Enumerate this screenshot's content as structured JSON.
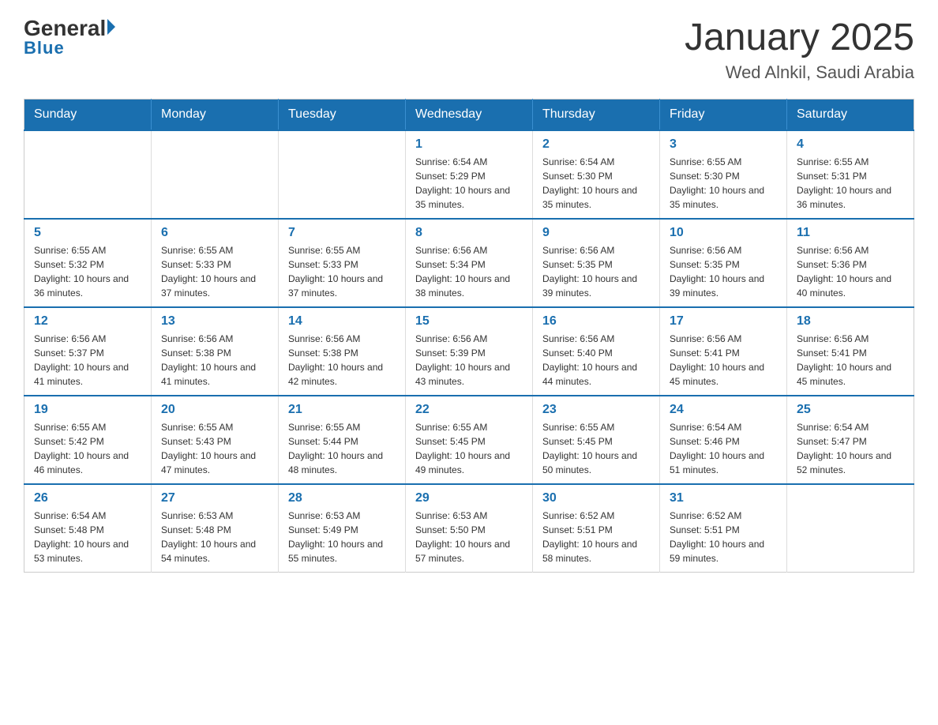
{
  "logo": {
    "general": "General",
    "blue": "Blue"
  },
  "title": "January 2025",
  "subtitle": "Wed Alnkil, Saudi Arabia",
  "days_header": [
    "Sunday",
    "Monday",
    "Tuesday",
    "Wednesday",
    "Thursday",
    "Friday",
    "Saturday"
  ],
  "weeks": [
    [
      {
        "num": "",
        "info": ""
      },
      {
        "num": "",
        "info": ""
      },
      {
        "num": "",
        "info": ""
      },
      {
        "num": "1",
        "info": "Sunrise: 6:54 AM\nSunset: 5:29 PM\nDaylight: 10 hours and 35 minutes."
      },
      {
        "num": "2",
        "info": "Sunrise: 6:54 AM\nSunset: 5:30 PM\nDaylight: 10 hours and 35 minutes."
      },
      {
        "num": "3",
        "info": "Sunrise: 6:55 AM\nSunset: 5:30 PM\nDaylight: 10 hours and 35 minutes."
      },
      {
        "num": "4",
        "info": "Sunrise: 6:55 AM\nSunset: 5:31 PM\nDaylight: 10 hours and 36 minutes."
      }
    ],
    [
      {
        "num": "5",
        "info": "Sunrise: 6:55 AM\nSunset: 5:32 PM\nDaylight: 10 hours and 36 minutes."
      },
      {
        "num": "6",
        "info": "Sunrise: 6:55 AM\nSunset: 5:33 PM\nDaylight: 10 hours and 37 minutes."
      },
      {
        "num": "7",
        "info": "Sunrise: 6:55 AM\nSunset: 5:33 PM\nDaylight: 10 hours and 37 minutes."
      },
      {
        "num": "8",
        "info": "Sunrise: 6:56 AM\nSunset: 5:34 PM\nDaylight: 10 hours and 38 minutes."
      },
      {
        "num": "9",
        "info": "Sunrise: 6:56 AM\nSunset: 5:35 PM\nDaylight: 10 hours and 39 minutes."
      },
      {
        "num": "10",
        "info": "Sunrise: 6:56 AM\nSunset: 5:35 PM\nDaylight: 10 hours and 39 minutes."
      },
      {
        "num": "11",
        "info": "Sunrise: 6:56 AM\nSunset: 5:36 PM\nDaylight: 10 hours and 40 minutes."
      }
    ],
    [
      {
        "num": "12",
        "info": "Sunrise: 6:56 AM\nSunset: 5:37 PM\nDaylight: 10 hours and 41 minutes."
      },
      {
        "num": "13",
        "info": "Sunrise: 6:56 AM\nSunset: 5:38 PM\nDaylight: 10 hours and 41 minutes."
      },
      {
        "num": "14",
        "info": "Sunrise: 6:56 AM\nSunset: 5:38 PM\nDaylight: 10 hours and 42 minutes."
      },
      {
        "num": "15",
        "info": "Sunrise: 6:56 AM\nSunset: 5:39 PM\nDaylight: 10 hours and 43 minutes."
      },
      {
        "num": "16",
        "info": "Sunrise: 6:56 AM\nSunset: 5:40 PM\nDaylight: 10 hours and 44 minutes."
      },
      {
        "num": "17",
        "info": "Sunrise: 6:56 AM\nSunset: 5:41 PM\nDaylight: 10 hours and 45 minutes."
      },
      {
        "num": "18",
        "info": "Sunrise: 6:56 AM\nSunset: 5:41 PM\nDaylight: 10 hours and 45 minutes."
      }
    ],
    [
      {
        "num": "19",
        "info": "Sunrise: 6:55 AM\nSunset: 5:42 PM\nDaylight: 10 hours and 46 minutes."
      },
      {
        "num": "20",
        "info": "Sunrise: 6:55 AM\nSunset: 5:43 PM\nDaylight: 10 hours and 47 minutes."
      },
      {
        "num": "21",
        "info": "Sunrise: 6:55 AM\nSunset: 5:44 PM\nDaylight: 10 hours and 48 minutes."
      },
      {
        "num": "22",
        "info": "Sunrise: 6:55 AM\nSunset: 5:45 PM\nDaylight: 10 hours and 49 minutes."
      },
      {
        "num": "23",
        "info": "Sunrise: 6:55 AM\nSunset: 5:45 PM\nDaylight: 10 hours and 50 minutes."
      },
      {
        "num": "24",
        "info": "Sunrise: 6:54 AM\nSunset: 5:46 PM\nDaylight: 10 hours and 51 minutes."
      },
      {
        "num": "25",
        "info": "Sunrise: 6:54 AM\nSunset: 5:47 PM\nDaylight: 10 hours and 52 minutes."
      }
    ],
    [
      {
        "num": "26",
        "info": "Sunrise: 6:54 AM\nSunset: 5:48 PM\nDaylight: 10 hours and 53 minutes."
      },
      {
        "num": "27",
        "info": "Sunrise: 6:53 AM\nSunset: 5:48 PM\nDaylight: 10 hours and 54 minutes."
      },
      {
        "num": "28",
        "info": "Sunrise: 6:53 AM\nSunset: 5:49 PM\nDaylight: 10 hours and 55 minutes."
      },
      {
        "num": "29",
        "info": "Sunrise: 6:53 AM\nSunset: 5:50 PM\nDaylight: 10 hours and 57 minutes."
      },
      {
        "num": "30",
        "info": "Sunrise: 6:52 AM\nSunset: 5:51 PM\nDaylight: 10 hours and 58 minutes."
      },
      {
        "num": "31",
        "info": "Sunrise: 6:52 AM\nSunset: 5:51 PM\nDaylight: 10 hours and 59 minutes."
      },
      {
        "num": "",
        "info": ""
      }
    ]
  ]
}
